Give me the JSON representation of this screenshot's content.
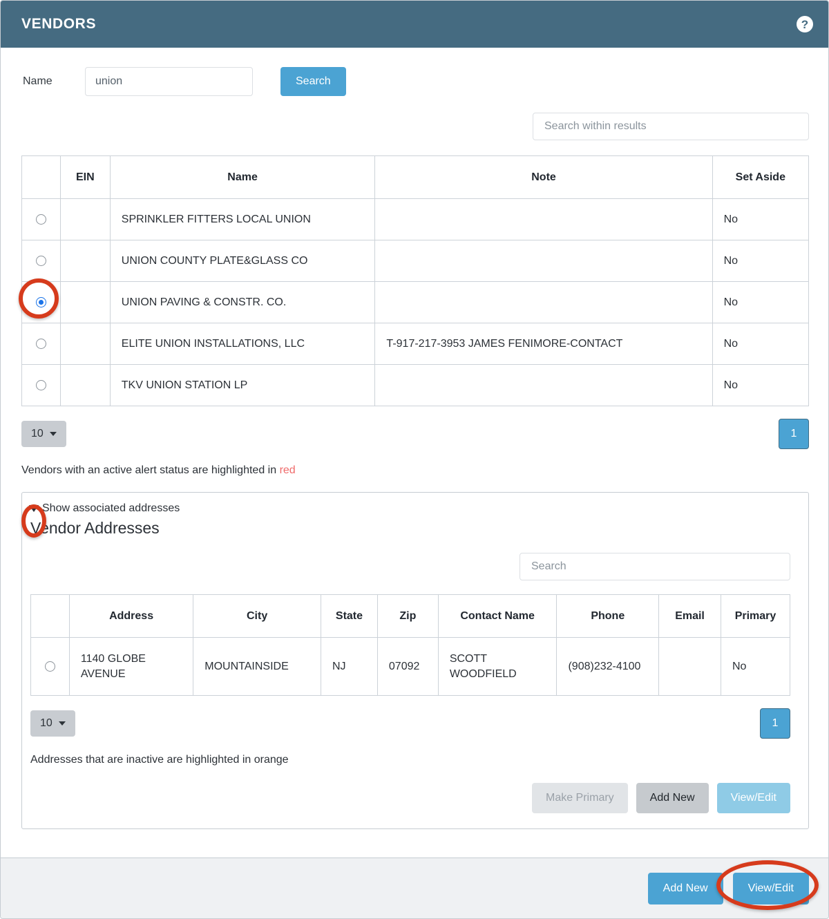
{
  "window": {
    "title": "VENDORS",
    "help_icon": "help-circle-icon"
  },
  "search": {
    "name_label": "Name",
    "name_value": "union",
    "name_placeholder": "",
    "search_button": "Search",
    "within_results_placeholder": "Search within results"
  },
  "vendors_table": {
    "columns": [
      "",
      "EIN",
      "Name",
      "Note",
      "Set Aside"
    ],
    "rows": [
      {
        "selected": false,
        "ein": "",
        "name": "SPRINKLER FITTERS LOCAL UNION",
        "note": "",
        "set_aside": "No"
      },
      {
        "selected": false,
        "ein": "",
        "name": "UNION COUNTY PLATE&GLASS CO",
        "note": "",
        "set_aside": "No"
      },
      {
        "selected": true,
        "ein": "",
        "name": "UNION PAVING & CONSTR. CO.",
        "note": "",
        "set_aside": "No"
      },
      {
        "selected": false,
        "ein": "",
        "name": "ELITE UNION INSTALLATIONS, LLC",
        "note": "T-917-217-3953 JAMES FENIMORE-CONTACT",
        "set_aside": "No"
      },
      {
        "selected": false,
        "ein": "",
        "name": "TKV UNION STATION LP",
        "note": "",
        "set_aside": "No"
      }
    ]
  },
  "vendors_pager": {
    "page_size": "10",
    "current_page": "1"
  },
  "vendors_legend": {
    "text": "Vendors with an active alert status are highlighted in ",
    "highlight_word": "red",
    "highlight_color": "#ef6a6a"
  },
  "addresses_panel": {
    "disclosure_label": "Show associated addresses",
    "disclosure_icon": "triangle-down-icon",
    "title": "Vendor Addresses",
    "search_placeholder": "Search",
    "columns": [
      "",
      "Address",
      "City",
      "State",
      "Zip",
      "Contact Name",
      "Phone",
      "Email",
      "Primary"
    ],
    "rows": [
      {
        "selected": false,
        "address": "1140 GLOBE AVENUE",
        "city": "MOUNTAINSIDE",
        "state": "NJ",
        "zip": "07092",
        "contact_name": "SCOTT WOODFIELD",
        "phone": "(908)232-4100",
        "email": "",
        "primary": "No"
      }
    ],
    "pager": {
      "page_size": "10",
      "current_page": "1"
    },
    "legend": {
      "text": "Addresses that are inactive are highlighted in ",
      "highlight_word": "orange",
      "highlight_color": "#e8901f"
    },
    "actions": {
      "make_primary": "Make Primary",
      "add_new": "Add New",
      "view_edit": "View/Edit"
    }
  },
  "footer": {
    "add_new": "Add New",
    "view_edit": "View/Edit"
  },
  "colors": {
    "titlebar": "#456b81",
    "primary": "#4ba3d3",
    "annotation": "#d63b1c",
    "footer_bg": "#eff1f3"
  }
}
